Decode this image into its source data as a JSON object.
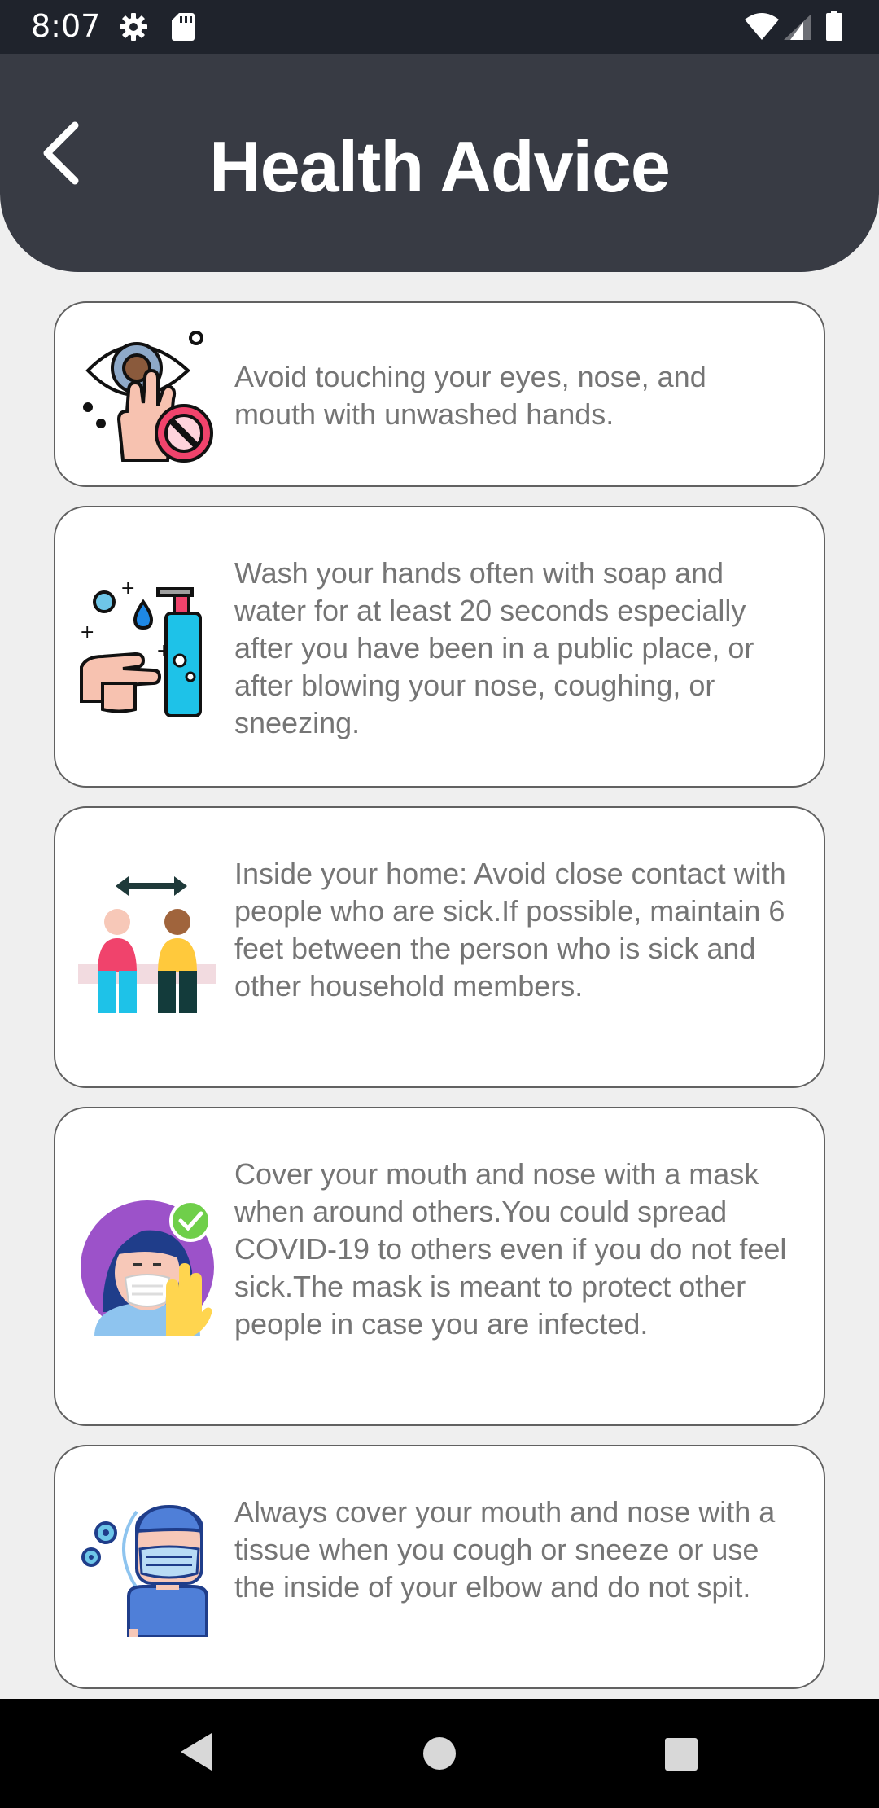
{
  "status_bar": {
    "time": "8:07",
    "icons": [
      "gear-icon",
      "sd-card-icon",
      "wifi-icon",
      "signal-icon",
      "battery-icon"
    ]
  },
  "header": {
    "title": "Health Advice",
    "back_icon": "chevron-left-icon",
    "background": "#383b44"
  },
  "advice": [
    {
      "icon": "no-touch-face-icon",
      "text": "Avoid touching your eyes, nose, and mouth with unwashed hands."
    },
    {
      "icon": "hand-wash-icon",
      "text": "Wash your hands often with soap and water for at least 20 seconds especially after you have been in a public place, or after blowing your nose, coughing, or sneezing."
    },
    {
      "icon": "social-distance-icon",
      "text": "Inside your home: Avoid close contact with people who are sick.If possible, maintain 6 feet between the person who is sick and other household members."
    },
    {
      "icon": "face-mask-icon",
      "text": "Cover your mouth and nose with a mask when around others.You could spread COVID-19 to others even if you do not feel sick.The mask is meant to protect other people in case you are infected."
    },
    {
      "icon": "cough-cover-icon",
      "text": "Always cover your mouth and nose with a tissue when you cough or sneeze or use the inside of your elbow and do not spit."
    }
  ],
  "nav_bar": {
    "icons": [
      "nav-back-icon",
      "nav-home-icon",
      "nav-recents-icon"
    ]
  },
  "colors": {
    "status_bar": "#1f232c",
    "page_background": "#efefef",
    "card_border": "#616161",
    "card_text": "#757575"
  }
}
